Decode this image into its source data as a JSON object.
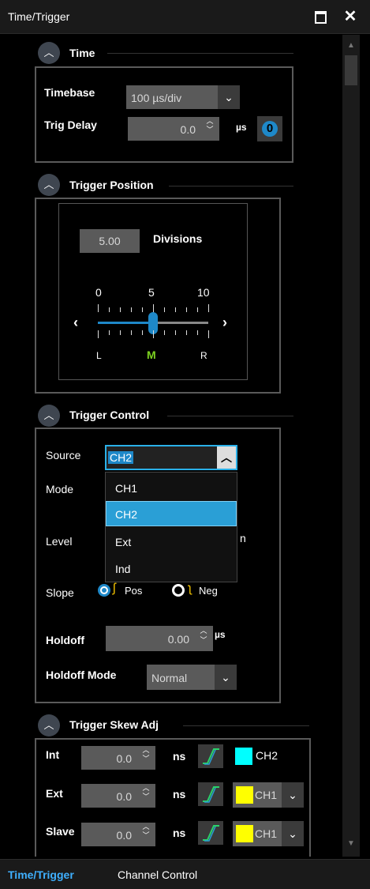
{
  "window": {
    "title": "Time/Trigger",
    "maximize_label": "",
    "close_label": "✕"
  },
  "time": {
    "header": "Time",
    "timebase_label": "Timebase",
    "timebase_value": "100  µs/div",
    "trig_delay_label": "Trig Delay",
    "trig_delay_value": "0.0",
    "trig_delay_unit": "µs",
    "zero_button": "0"
  },
  "trigger_position": {
    "header": "Trigger Position",
    "divisions_value": "5.00",
    "divisions_label": "Divisions",
    "scale_labels": [
      "0",
      "5",
      "10"
    ],
    "pos_labels": [
      "L",
      "M",
      "R"
    ],
    "slider_fraction": 0.5
  },
  "trigger_control": {
    "header": "Trigger Control",
    "source_label": "Source",
    "source_value": "CH2",
    "mode_label": "Mode",
    "level_label": "Level",
    "level_partial": "n",
    "options": [
      "CH1",
      "CH2",
      "Ext",
      "Ind"
    ],
    "selected_option": "CH2",
    "slope_label": "Slope",
    "slope_pos": "Pos",
    "slope_neg": "Neg",
    "holdoff_label": "Holdoff",
    "holdoff_value": "0.00",
    "holdoff_unit": "µs",
    "holdoff_mode_label": "Holdoff Mode",
    "holdoff_mode_value": "Normal"
  },
  "skew": {
    "header": "Trigger Skew Adj",
    "rows": [
      {
        "label": "Int",
        "value": "0.0",
        "unit": "ns",
        "channel": "CH2",
        "swatch": "#00ffff",
        "dropdown": false
      },
      {
        "label": "Ext",
        "value": "0.0",
        "unit": "ns",
        "channel": "CH1",
        "swatch": "#ffff00",
        "dropdown": true
      },
      {
        "label": "Slave",
        "value": "0.0",
        "unit": "ns",
        "channel": "CH1",
        "swatch": "#ffff00",
        "dropdown": true
      }
    ]
  },
  "tabs": [
    {
      "label": "Time/Trigger",
      "active": true
    },
    {
      "label": "Channel Control",
      "active": false
    }
  ],
  "colors": {
    "accent": "#1e88c8",
    "selected_item": "#2a9fd6",
    "marker_green": "#7ed321",
    "active_tab": "#3fb0ff"
  }
}
